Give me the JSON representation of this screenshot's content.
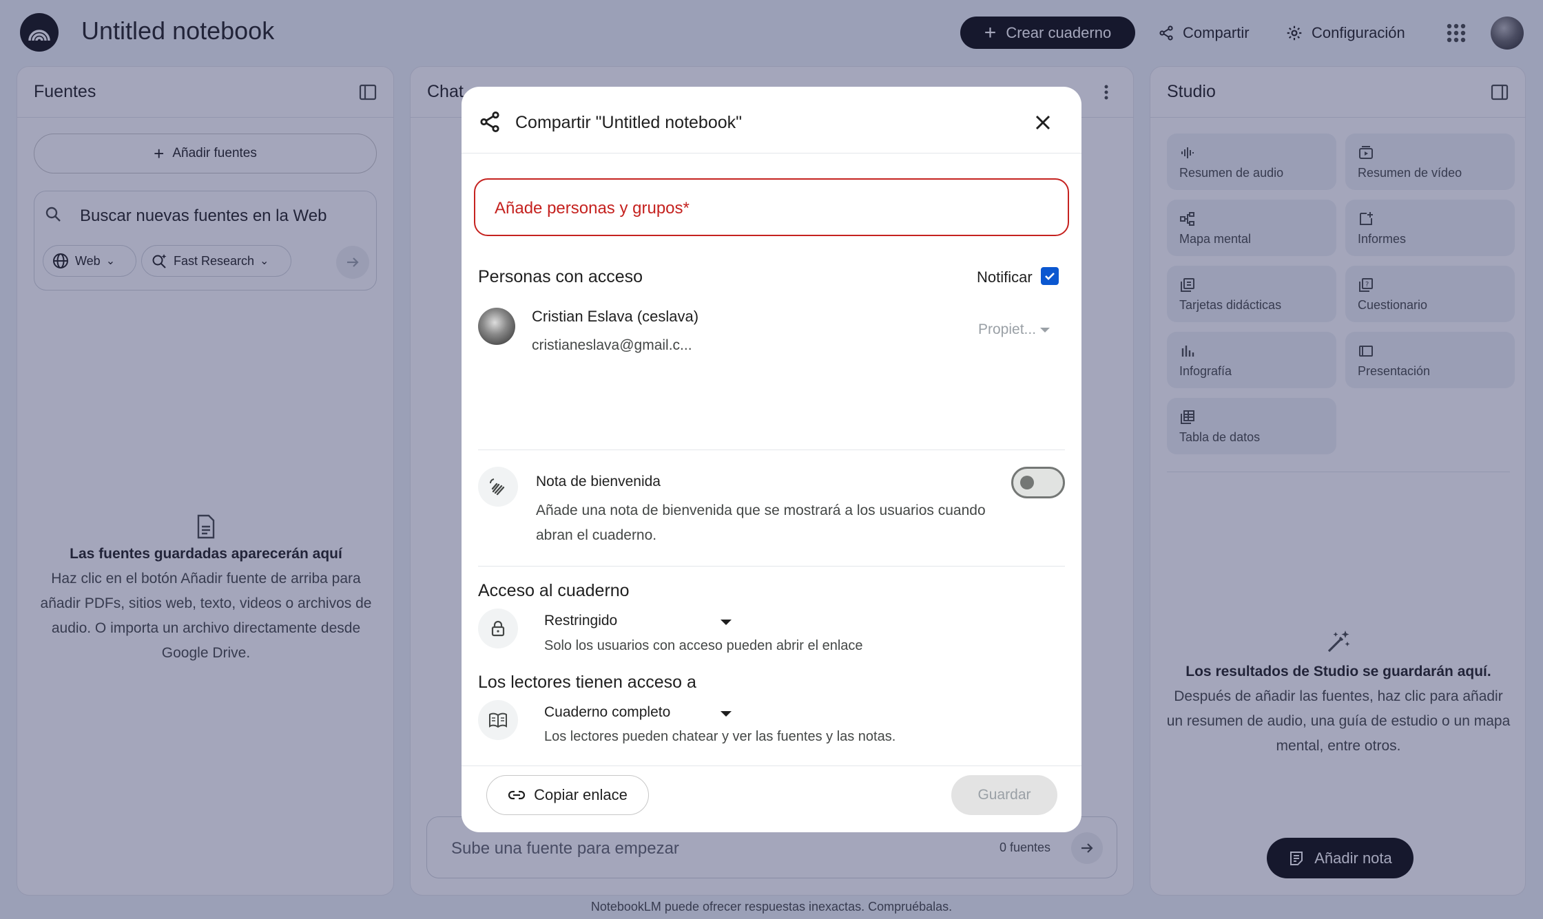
{
  "header": {
    "notebook_title": "Untitled notebook",
    "create_label": "Crear cuaderno",
    "share_label": "Compartir",
    "settings_label": "Configuración"
  },
  "sources": {
    "title": "Fuentes",
    "add_label": "Añadir fuentes",
    "search_placeholder": "Buscar nuevas fuentes en la Web",
    "chip_web": "Web",
    "chip_fast": "Fast Research",
    "empty_title": "Las fuentes guardadas aparecerán aquí",
    "empty_desc": "Haz clic en el botón Añadir fuente de arriba para añadir PDFs, sitios web, texto, videos o archivos de audio. O importa un archivo directamente desde Google Drive."
  },
  "chat": {
    "title": "Chat",
    "input_placeholder": "Sube una fuente para empezar",
    "source_count": "0 fuentes"
  },
  "studio": {
    "title": "Studio",
    "tiles": [
      {
        "label": "Resumen de audio",
        "icon": "audio-wave-icon"
      },
      {
        "label": "Resumen de vídeo",
        "icon": "video-icon"
      },
      {
        "label": "Mapa mental",
        "icon": "mindmap-icon"
      },
      {
        "label": "Informes",
        "icon": "report-icon"
      },
      {
        "label": "Tarjetas didácticas",
        "icon": "flashcards-icon"
      },
      {
        "label": "Cuestionario",
        "icon": "quiz-icon"
      },
      {
        "label": "Infografía",
        "icon": "infographic-icon"
      },
      {
        "label": "Presentación",
        "icon": "presentation-icon"
      },
      {
        "label": "Tabla de datos",
        "icon": "table-icon"
      }
    ],
    "empty_title": "Los resultados de Studio se guardarán aquí.",
    "empty_desc": "Después de añadir las fuentes, haz clic para añadir un resumen de audio, una guía de estudio o un mapa mental, entre otros.",
    "add_note_label": "Añadir nota"
  },
  "footer_note": "NotebookLM puede ofrecer respuestas inexactas. Compruébalas.",
  "dialog": {
    "title": "Compartir \"Untitled notebook\"",
    "people_placeholder": "Añade personas y grupos*",
    "access_title": "Personas con acceso",
    "notify_label": "Notificar",
    "notify_checked": true,
    "user": {
      "name": "Cristian Eslava (ceslava)",
      "email": "cristianeslava@gmail.c...",
      "role": "Propiet..."
    },
    "welcome": {
      "title": "Nota de bienvenida",
      "desc": "Añade una nota de bienvenida que se mostrará a los usuarios cuando abran el cuaderno.",
      "enabled": false
    },
    "notebook_access": {
      "title": "Acceso al cuaderno",
      "value": "Restringido",
      "desc": "Solo los usuarios con acceso pueden abrir el enlace"
    },
    "reader_access": {
      "title": "Los lectores tienen acceso a",
      "value": "Cuaderno completo",
      "desc": "Los lectores pueden chatear y ver las fuentes y las notas."
    },
    "copy_link_label": "Copiar enlace",
    "save_label": "Guardar"
  },
  "colors": {
    "accent": "#0b57d0",
    "error": "#c5221f",
    "scrim": "#262a5e"
  }
}
